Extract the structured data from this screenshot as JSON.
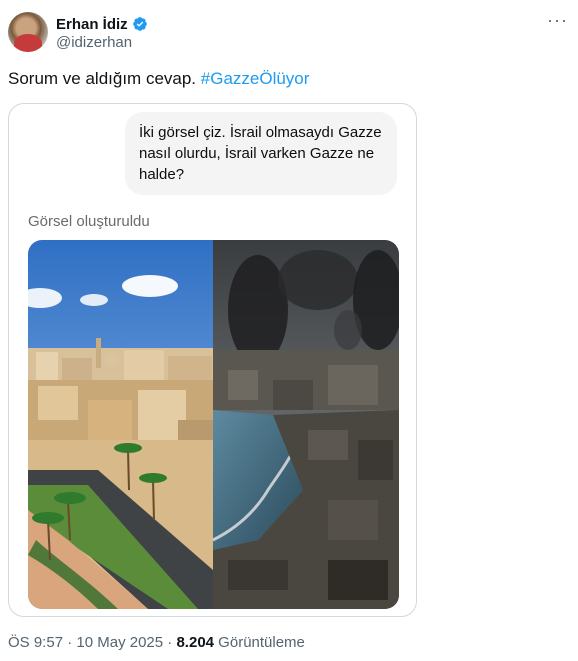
{
  "author": {
    "name": "Erhan İdiz",
    "handle": "@idizerhan"
  },
  "tweet": {
    "text": "Sorum ve aldığım cevap. ",
    "hashtag": "#GazzeÖlüyor"
  },
  "card": {
    "prompt": "İki görsel çiz. İsrail olmasaydı Gazze nasıl olurdu, İsrail varken Gazze ne halde?",
    "status": "Görsel oluşturuldu"
  },
  "meta": {
    "time": "ÖS 9:57",
    "sep1": " · ",
    "date": "10 May 2025",
    "sep2": " · ",
    "views": "8.204",
    "views_label": " Görüntüleme"
  },
  "icons": {
    "verified": "verified-badge-icon",
    "more": "more-options-icon"
  },
  "colors": {
    "accent": "#1d9bf0",
    "secondary_text": "#536471"
  }
}
